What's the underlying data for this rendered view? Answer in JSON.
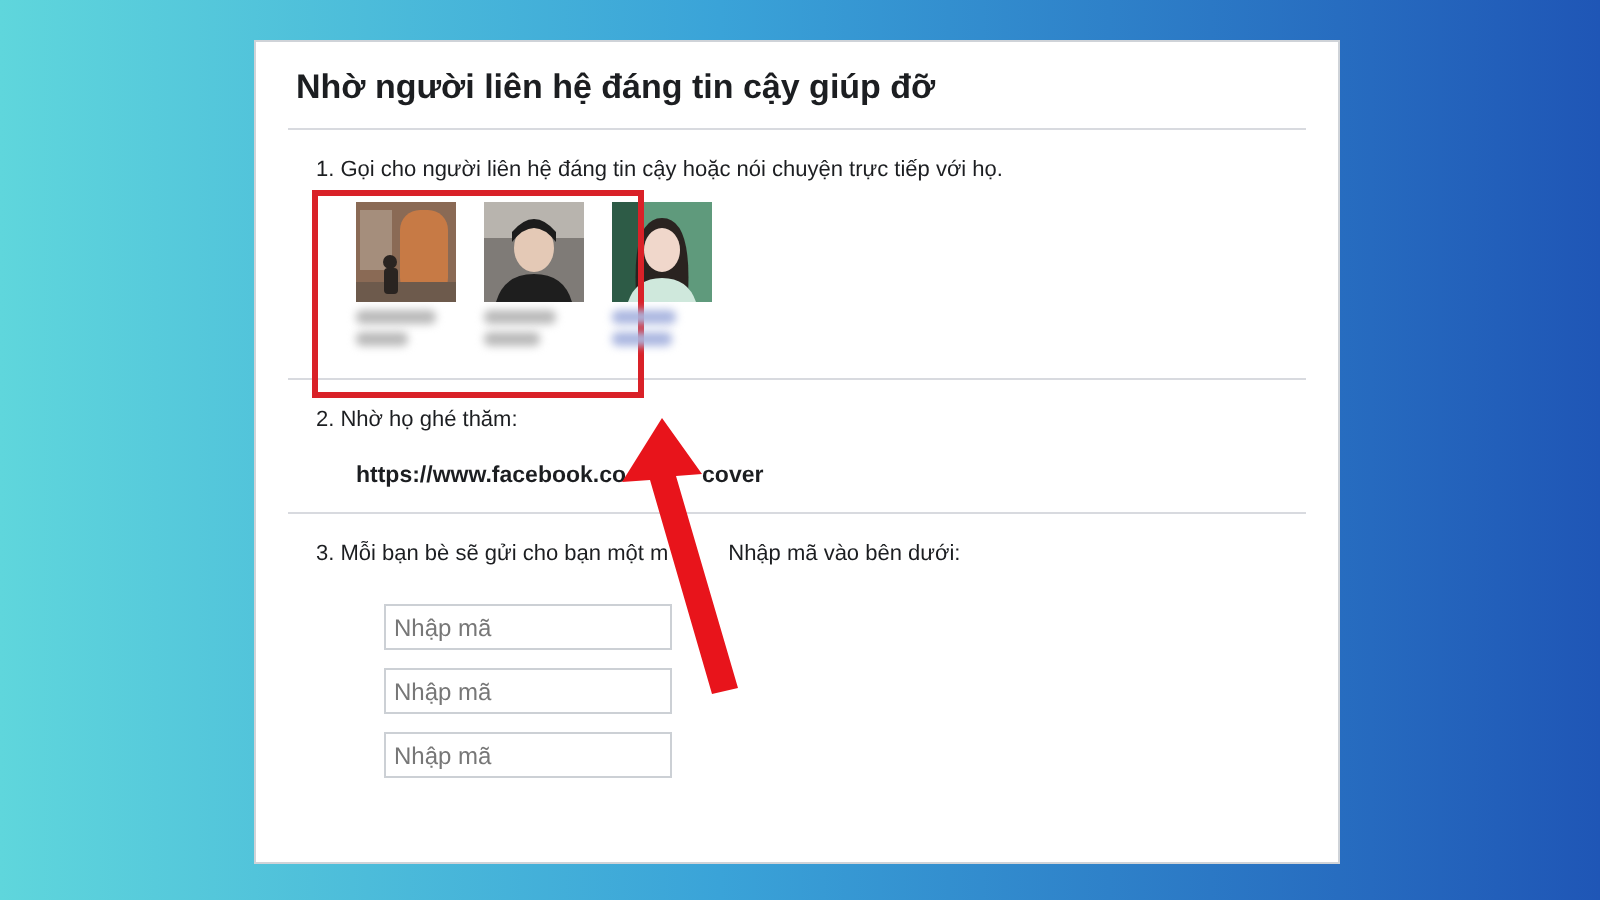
{
  "dialog": {
    "title": "Nhờ người liên hệ đáng tin cậy giúp đỡ",
    "step_1": {
      "text": "1. Gọi cho người liên hệ đáng tin cậy hoặc nói chuyện trực tiếp với họ."
    },
    "step_2": {
      "text": "2. Nhờ họ ghé thăm:",
      "link_parts": [
        "https://www.facebook.co",
        "cover"
      ]
    },
    "step_3": {
      "text_parts": [
        "3. Mỗi bạn bè sẽ gửi cho bạn một m",
        "Nhập mã vào bên dưới:"
      ],
      "fields": [
        {
          "placeholder": "Nhập mã"
        },
        {
          "placeholder": "Nhập mã"
        },
        {
          "placeholder": "Nhập mã"
        }
      ]
    }
  }
}
